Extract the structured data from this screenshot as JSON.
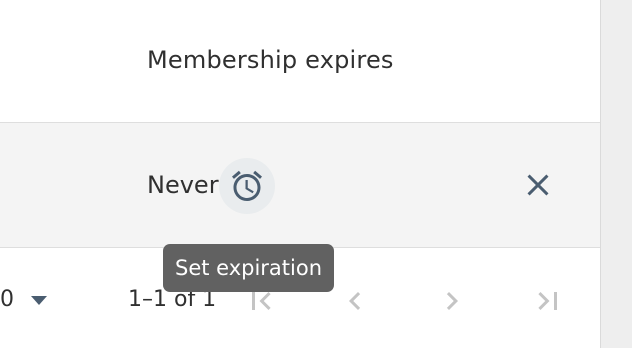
{
  "table": {
    "header": {
      "membership_expires": "Membership expires"
    },
    "row": {
      "expires_value": "Never",
      "alarm_icon": "alarm-clock-icon",
      "remove_icon": "close-icon"
    }
  },
  "tooltip": {
    "text": "Set expiration"
  },
  "pagination": {
    "rows_per_page_value": "0",
    "range_text": "1–1 of 1",
    "icons": [
      "first-page-icon",
      "chevron-left-icon",
      "chevron-right-icon",
      "last-page-icon"
    ]
  },
  "colors": {
    "icon": "#4a5d70",
    "icon_disabled": "#c4c4c4",
    "row_bg": "#f4f4f4",
    "tooltip_bg": "#616161"
  }
}
